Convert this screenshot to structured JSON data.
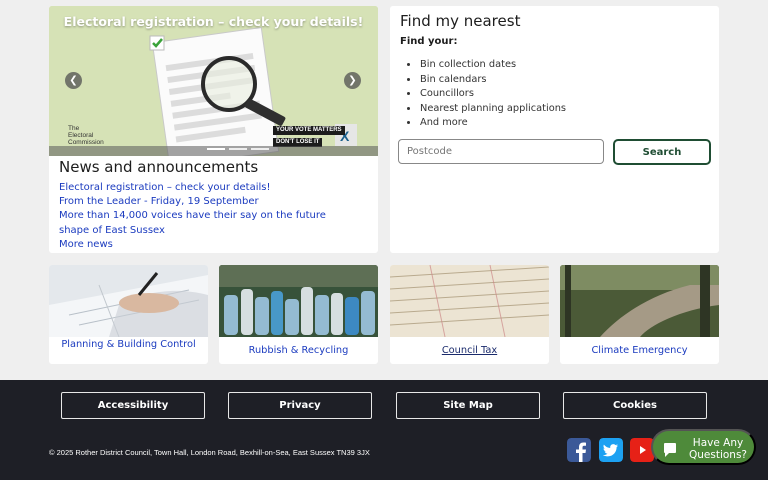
{
  "carousel": {
    "slide_title": "Electoral registration – check your details!",
    "logo_line1": "The",
    "logo_line2": "Electoral",
    "logo_line3": "Commission",
    "tag1": "YOUR VOTE MATTERS",
    "tag2": "DON'T LOSE IT",
    "prev_glyph": "❮",
    "next_glyph": "❯",
    "slide_count": 3,
    "active_slide": 1
  },
  "news": {
    "heading": "News and announcements",
    "items": [
      "Electoral registration – check your details!",
      "From the Leader - Friday, 19 September",
      "More than 14,000 voices have their say on the future shape of East Sussex"
    ],
    "more_label": "More news"
  },
  "find": {
    "heading": "Find my nearest",
    "subheading": "Find your:",
    "items": [
      "Bin collection dates",
      "Bin calendars",
      "Councillors",
      "Nearest planning applications",
      "And more"
    ],
    "postcode_placeholder": "Postcode",
    "search_label": "Search"
  },
  "tiles": [
    {
      "label": "Planning & Building Control"
    },
    {
      "label": "Rubbish & Recycling"
    },
    {
      "label": "Council Tax"
    },
    {
      "label": "Climate Emergency"
    }
  ],
  "footer": {
    "buttons": [
      "Accessibility",
      "Privacy",
      "Site Map",
      "Cookies"
    ],
    "copyright": "© 2025 Rother District Council, Town Hall, London Road, Bexhill-on-Sea, East Sussex TN39 3JX",
    "social": [
      "facebook-icon",
      "twitter-icon",
      "youtube-icon"
    ],
    "chat_label": "Have Any Questions?"
  },
  "colors": {
    "link": "#1b3bbf",
    "footer_bg": "#1e1f26",
    "search_border": "#1f4d33",
    "chat_bg": "#4e8a3a",
    "facebook": "#3b5998",
    "twitter": "#1da1f2",
    "youtube": "#e62117"
  }
}
